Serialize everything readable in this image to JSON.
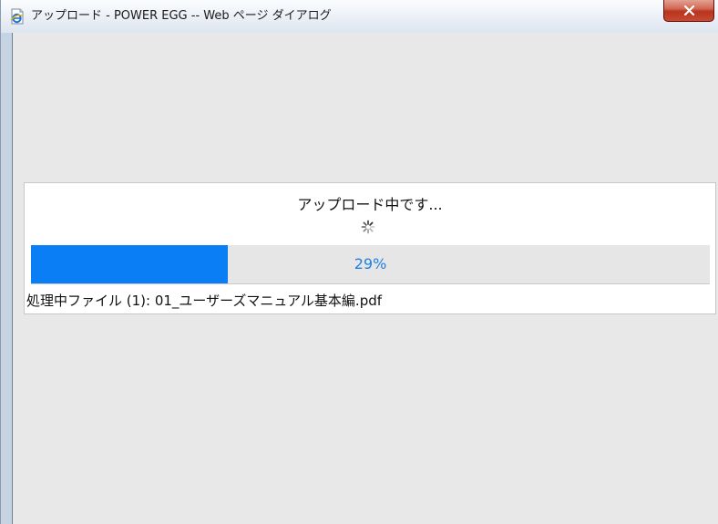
{
  "window": {
    "title": "アップロード - POWER EGG -- Web ページ ダイアログ",
    "close_label": "x"
  },
  "upload": {
    "status": "アップロード中です...",
    "progress_percent": 29,
    "progress_label": "29%",
    "file_label": "処理中ファイル (1): 01_ユーザーズマニュアル基本編.pdf"
  },
  "colors": {
    "progress_fill": "#0a7ff5",
    "progress_track": "#e6e6e6",
    "progress_text": "#1f7fe0",
    "client_background": "#e8e8e8"
  },
  "icons": {
    "app": "ie-page-icon",
    "close": "close-icon",
    "loading": "spinner-icon"
  }
}
